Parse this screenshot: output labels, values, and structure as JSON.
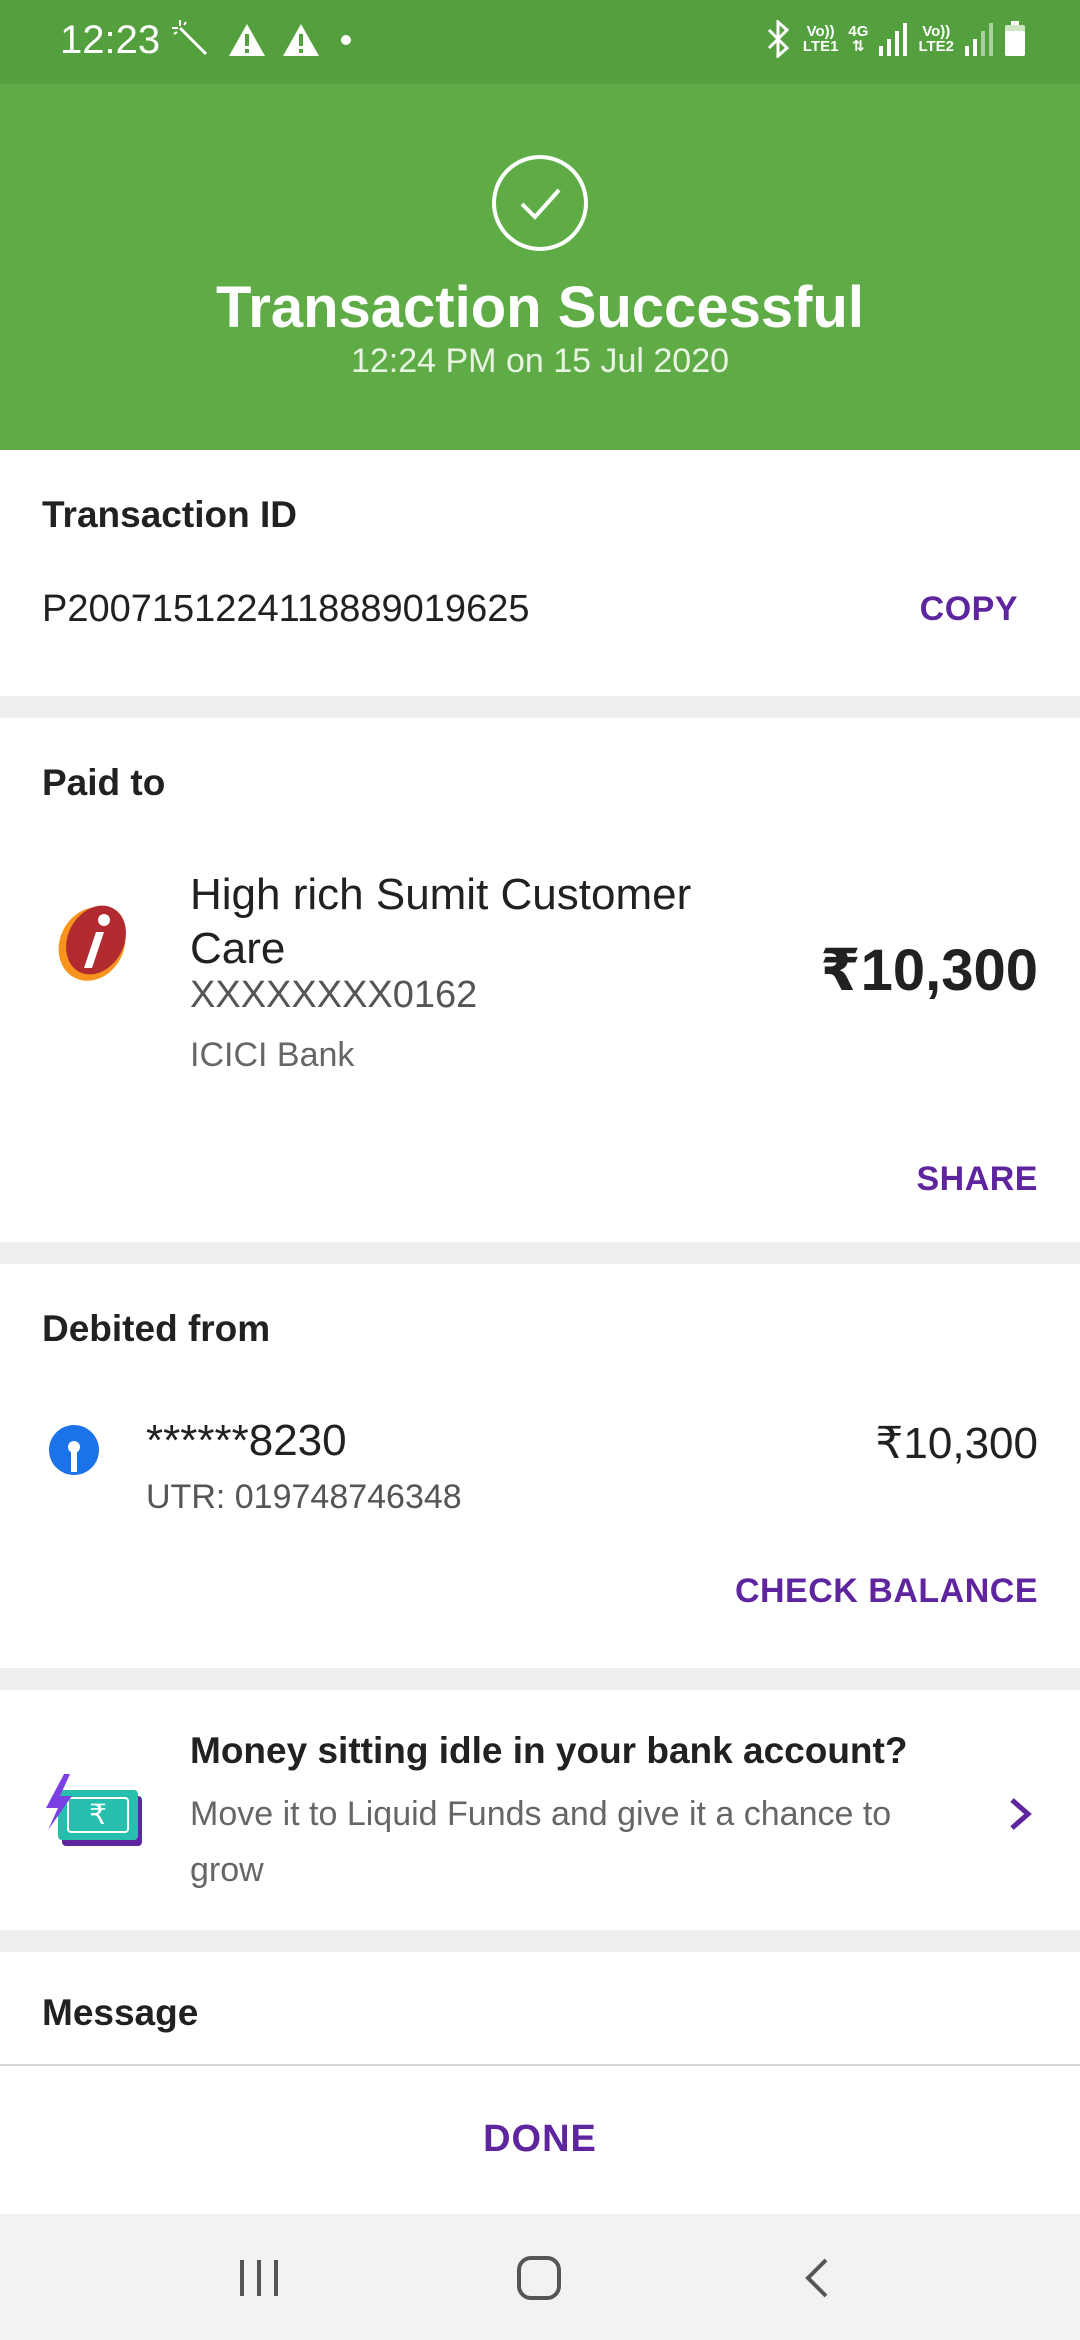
{
  "status_bar": {
    "time": "12:23",
    "sim1_top": "Vo))",
    "sim1_bottom": "LTE1",
    "network": "4G",
    "sim2_top": "Vo))",
    "sim2_bottom": "LTE2"
  },
  "header": {
    "title": "Transaction Successful",
    "subtitle": "12:24 PM on 15 Jul 2020",
    "background_color": "#5fac46"
  },
  "transaction": {
    "label": "Transaction ID",
    "id": "P2007151224118889019625",
    "copy_label": "COPY"
  },
  "paid_to": {
    "label": "Paid to",
    "name": "High rich Sumit Customer Care",
    "account": "XXXXXXXX0162",
    "bank": "ICICI Bank",
    "amount": "₹10,300",
    "share_label": "SHARE",
    "bank_icon": "icici-logo-icon"
  },
  "debited_from": {
    "label": "Debited from",
    "account": "******8230",
    "utr": "UTR: 019748746348",
    "amount": "₹10,300",
    "check_balance_label": "CHECK BALANCE",
    "bank_icon": "sbi-logo-icon"
  },
  "promo": {
    "title": "Money sitting idle in your bank account?",
    "body": "Move it to Liquid Funds and give it a chance to grow",
    "rupee_symbol": "₹"
  },
  "message": {
    "label": "Message"
  },
  "footer": {
    "done_label": "DONE"
  },
  "colors": {
    "accent": "#5f259f",
    "success": "#5fac46"
  }
}
